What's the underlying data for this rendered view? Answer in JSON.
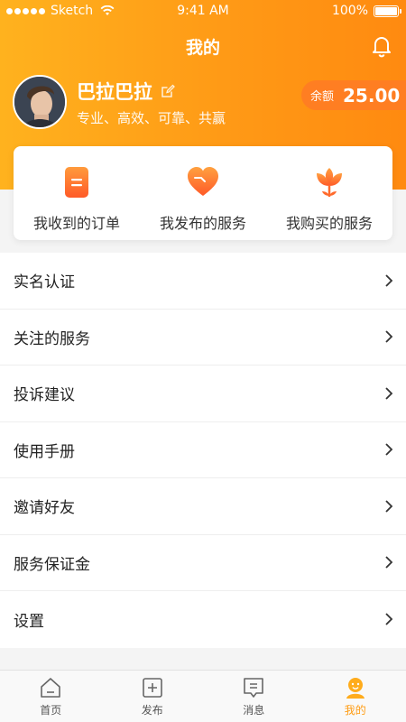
{
  "status_bar": {
    "carrier": "Sketch",
    "time": "9:41 AM",
    "battery": "100%"
  },
  "header": {
    "title": "我的"
  },
  "profile": {
    "name": "巴拉巴拉",
    "tagline": "专业、高效、可靠、共赢"
  },
  "balance": {
    "label": "余额",
    "value": "25.00"
  },
  "quick_actions": [
    {
      "label": "我收到的订单",
      "icon": "order-icon"
    },
    {
      "label": "我发布的服务",
      "icon": "heart-icon"
    },
    {
      "label": "我购买的服务",
      "icon": "flower-icon"
    }
  ],
  "menu": [
    {
      "label": "实名认证"
    },
    {
      "label": "关注的服务"
    },
    {
      "label": "投诉建议"
    },
    {
      "label": "使用手册"
    },
    {
      "label": "邀请好友"
    },
    {
      "label": "服务保证金"
    },
    {
      "label": "设置"
    }
  ],
  "tabbar": [
    {
      "label": "首页",
      "icon": "home-icon"
    },
    {
      "label": "发布",
      "icon": "add-icon"
    },
    {
      "label": "消息",
      "icon": "message-icon"
    },
    {
      "label": "我的",
      "icon": "profile-icon",
      "active": true
    }
  ],
  "colors": {
    "accent": "#ff9c13",
    "gradient_start": "#ffb21e",
    "gradient_end": "#ff8a10"
  }
}
